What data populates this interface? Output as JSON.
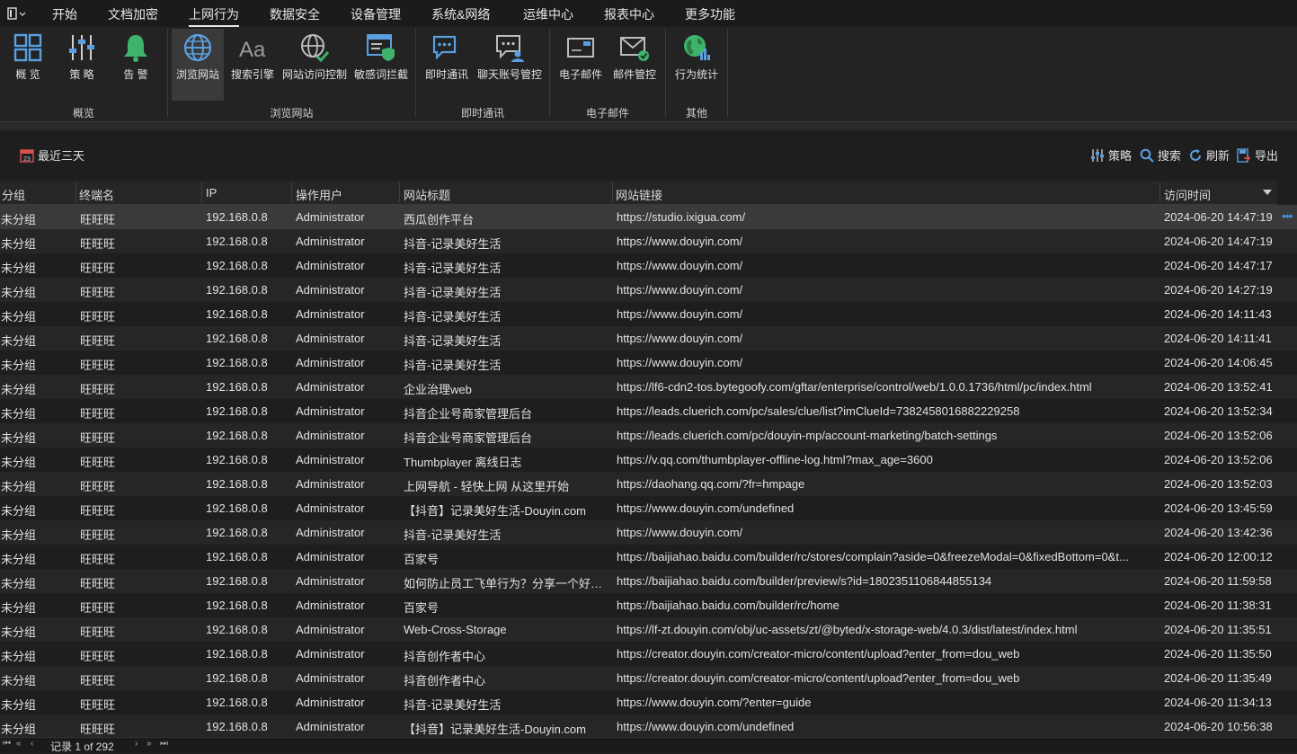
{
  "menu": {
    "tabs": [
      {
        "label": "开始"
      },
      {
        "label": "文档加密"
      },
      {
        "label": "上网行为"
      },
      {
        "label": "数据安全"
      },
      {
        "label": "设备管理"
      },
      {
        "label": "系统&网络"
      },
      {
        "label": "运维中心"
      },
      {
        "label": "报表中心"
      },
      {
        "label": "更多功能"
      }
    ],
    "active_tab": "上网行为"
  },
  "ribbon": {
    "buttons": [
      {
        "label": "概 览",
        "icon": "grid-icon"
      },
      {
        "label": "策 略",
        "icon": "sliders-icon"
      },
      {
        "label": "告 警",
        "icon": "bell-icon"
      },
      {
        "label": "浏览网站",
        "icon": "globe-icon"
      },
      {
        "label": "搜索引擎",
        "icon": "font-icon"
      },
      {
        "label": "网站访问控制",
        "icon": "globe-check-icon"
      },
      {
        "label": "敏感词拦截",
        "icon": "shield-browser-icon"
      },
      {
        "label": "即时通讯",
        "icon": "chat-icon"
      },
      {
        "label": "聊天账号管控",
        "icon": "chat-person-icon"
      },
      {
        "label": "电子邮件",
        "icon": "mail-icon"
      },
      {
        "label": "邮件管控",
        "icon": "mail-check-icon"
      },
      {
        "label": "行为统计",
        "icon": "globe-stats-icon"
      }
    ],
    "groups": [
      {
        "label": "概览"
      },
      {
        "label": "浏览网站"
      },
      {
        "label": "即时通讯"
      },
      {
        "label": "电子邮件"
      },
      {
        "label": "其他"
      }
    ]
  },
  "toolbar": {
    "date_range": "最近三天",
    "policy": "策略",
    "search": "搜索",
    "refresh": "刷新",
    "export": "导出"
  },
  "table": {
    "columns": [
      "分组",
      "终端名",
      "IP",
      "操作用户",
      "网站标题",
      "网站链接",
      "访问时间"
    ],
    "rows": [
      [
        "未分组",
        "旺旺旺",
        "192.168.0.8",
        "Administrator",
        "西瓜创作平台",
        "https://studio.ixigua.com/",
        "2024-06-20 14:47:19"
      ],
      [
        "未分组",
        "旺旺旺",
        "192.168.0.8",
        "Administrator",
        "抖音-记录美好生活",
        "https://www.douyin.com/",
        "2024-06-20 14:47:19"
      ],
      [
        "未分组",
        "旺旺旺",
        "192.168.0.8",
        "Administrator",
        "抖音-记录美好生活",
        "https://www.douyin.com/",
        "2024-06-20 14:47:17"
      ],
      [
        "未分组",
        "旺旺旺",
        "192.168.0.8",
        "Administrator",
        "抖音-记录美好生活",
        "https://www.douyin.com/",
        "2024-06-20 14:27:19"
      ],
      [
        "未分组",
        "旺旺旺",
        "192.168.0.8",
        "Administrator",
        "抖音-记录美好生活",
        "https://www.douyin.com/",
        "2024-06-20 14:11:43"
      ],
      [
        "未分组",
        "旺旺旺",
        "192.168.0.8",
        "Administrator",
        "抖音-记录美好生活",
        "https://www.douyin.com/",
        "2024-06-20 14:11:41"
      ],
      [
        "未分组",
        "旺旺旺",
        "192.168.0.8",
        "Administrator",
        "抖音-记录美好生活",
        "https://www.douyin.com/",
        "2024-06-20 14:06:45"
      ],
      [
        "未分组",
        "旺旺旺",
        "192.168.0.8",
        "Administrator",
        "企业治理web",
        "https://lf6-cdn2-tos.bytegoofy.com/gftar/enterprise/control/web/1.0.0.1736/html/pc/index.html",
        "2024-06-20 13:52:41"
      ],
      [
        "未分组",
        "旺旺旺",
        "192.168.0.8",
        "Administrator",
        "抖音企业号商家管理后台",
        "https://leads.cluerich.com/pc/sales/clue/list?imClueId=7382458016882229258",
        "2024-06-20 13:52:34"
      ],
      [
        "未分组",
        "旺旺旺",
        "192.168.0.8",
        "Administrator",
        "抖音企业号商家管理后台",
        "https://leads.cluerich.com/pc/douyin-mp/account-marketing/batch-settings",
        "2024-06-20 13:52:06"
      ],
      [
        "未分组",
        "旺旺旺",
        "192.168.0.8",
        "Administrator",
        "Thumbplayer 离线日志",
        "https://v.qq.com/thumbplayer-offline-log.html?max_age=3600",
        "2024-06-20 13:52:06"
      ],
      [
        "未分组",
        "旺旺旺",
        "192.168.0.8",
        "Administrator",
        "上网导航 - 轻快上网 从这里开始",
        "https://daohang.qq.com/?fr=hmpage",
        "2024-06-20 13:52:03"
      ],
      [
        "未分组",
        "旺旺旺",
        "192.168.0.8",
        "Administrator",
        "【抖音】记录美好生活-Douyin.com",
        "https://www.douyin.com/undefined",
        "2024-06-20 13:45:59"
      ],
      [
        "未分组",
        "旺旺旺",
        "192.168.0.8",
        "Administrator",
        "抖音-记录美好生活",
        "https://www.douyin.com/",
        "2024-06-20 13:42:36"
      ],
      [
        "未分组",
        "旺旺旺",
        "192.168.0.8",
        "Administrator",
        "百家号",
        "https://baijiahao.baidu.com/builder/rc/stores/complain?aside=0&freezeModal=0&fixedBottom=0&t...",
        "2024-06-20 12:00:12"
      ],
      [
        "未分组",
        "旺旺旺",
        "192.168.0.8",
        "Administrator",
        "如何防止员工飞单行为？分享一个好用的...",
        "https://baijiahao.baidu.com/builder/preview/s?id=1802351106844855134",
        "2024-06-20 11:59:58"
      ],
      [
        "未分组",
        "旺旺旺",
        "192.168.0.8",
        "Administrator",
        "百家号",
        "https://baijiahao.baidu.com/builder/rc/home",
        "2024-06-20 11:38:31"
      ],
      [
        "未分组",
        "旺旺旺",
        "192.168.0.8",
        "Administrator",
        "Web-Cross-Storage",
        "https://lf-zt.douyin.com/obj/uc-assets/zt/@byted/x-storage-web/4.0.3/dist/latest/index.html",
        "2024-06-20 11:35:51"
      ],
      [
        "未分组",
        "旺旺旺",
        "192.168.0.8",
        "Administrator",
        "抖音创作者中心",
        "https://creator.douyin.com/creator-micro/content/upload?enter_from=dou_web",
        "2024-06-20 11:35:50"
      ],
      [
        "未分组",
        "旺旺旺",
        "192.168.0.8",
        "Administrator",
        "抖音创作者中心",
        "https://creator.douyin.com/creator-micro/content/upload?enter_from=dou_web",
        "2024-06-20 11:35:49"
      ],
      [
        "未分组",
        "旺旺旺",
        "192.168.0.8",
        "Administrator",
        "抖音-记录美好生活",
        "https://www.douyin.com/?enter=guide",
        "2024-06-20 11:34:13"
      ],
      [
        "未分组",
        "旺旺旺",
        "192.168.0.8",
        "Administrator",
        "【抖音】记录美好生活-Douyin.com",
        "https://www.douyin.com/undefined",
        "2024-06-20 10:56:38"
      ]
    ]
  },
  "status": {
    "records": "记录 1 of 292"
  },
  "colors": {
    "accent_blue": "#4a8fd6",
    "accent_green": "#3fb36b",
    "bg": "#1e1e1e"
  }
}
